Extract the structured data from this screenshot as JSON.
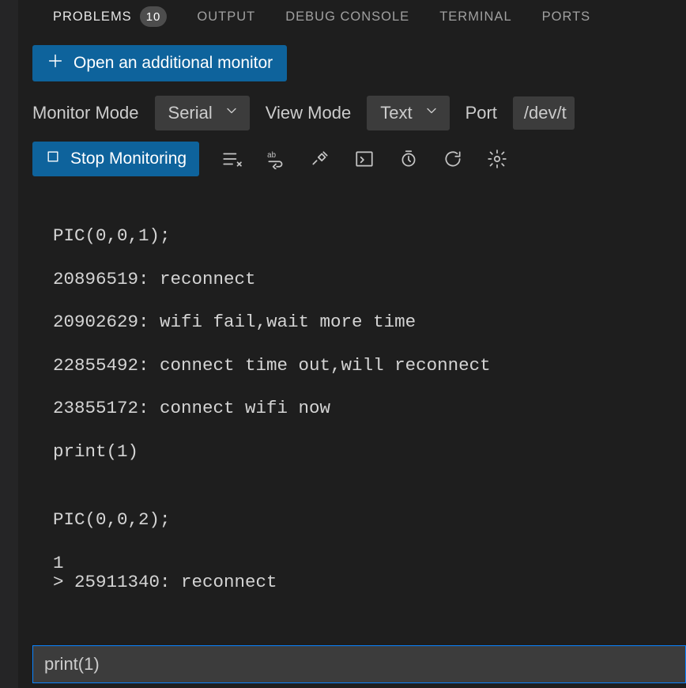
{
  "tabs": {
    "problems": {
      "label": "PROBLEMS",
      "badge": "10"
    },
    "output": {
      "label": "OUTPUT"
    },
    "debug": {
      "label": "DEBUG CONSOLE"
    },
    "terminal": {
      "label": "TERMINAL"
    },
    "ports": {
      "label": "PORTS"
    }
  },
  "buttons": {
    "open_monitor": "Open an additional monitor",
    "stop_monitor": "Stop Monitoring"
  },
  "controls": {
    "monitor_mode_label": "Monitor Mode",
    "monitor_mode_value": "Serial",
    "view_mode_label": "View Mode",
    "view_mode_value": "Text",
    "port_label": "Port",
    "port_value": "/dev/t"
  },
  "console_lines": [
    "PIC(0,0,1);",
    "20896519: reconnect",
    "20902629: wifi fail,wait more time",
    "22855492: connect time out,will reconnect",
    "23855172: connect wifi now",
    "print(1)",
    "",
    "PIC(0,0,2);",
    "1",
    "> 25911340: reconnect"
  ],
  "input_value": "print(1)"
}
